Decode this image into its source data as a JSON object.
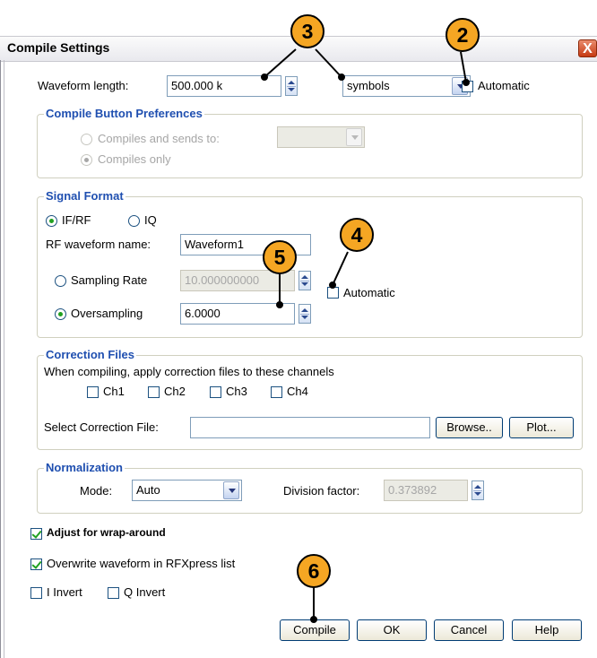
{
  "window": {
    "title": "Compile Settings",
    "close_glyph": "X"
  },
  "waveform": {
    "length_label": "Waveform length:",
    "length_value": "500.000 k",
    "unit_value": "symbols",
    "automatic_label": "Automatic",
    "automatic_checked": false
  },
  "compile_prefs": {
    "title": "Compile Button Preferences",
    "option_send_label": "Compiles and sends to:",
    "option_only_label": "Compiles only",
    "selected": "Compiles only"
  },
  "signal_format": {
    "title": "Signal Format",
    "ifrf_label": "IF/RF",
    "iq_label": "IQ",
    "selected": "IF/RF",
    "rf_name_label": "RF waveform name:",
    "rf_name_value": "Waveform1",
    "sampling_rate_label": "Sampling Rate",
    "sampling_rate_value": "10.000000000",
    "oversampling_label": "Oversampling",
    "oversampling_value": "6.0000",
    "automatic_label": "Automatic",
    "automatic_checked": false
  },
  "correction": {
    "title": "Correction Files",
    "description": "When compiling, apply correction files to these channels",
    "channels": [
      "Ch1",
      "Ch2",
      "Ch3",
      "Ch4"
    ],
    "select_label": "Select Correction File:",
    "file_value": "",
    "browse_label": "Browse..",
    "plot_label": "Plot..."
  },
  "normalization": {
    "title": "Normalization",
    "mode_label": "Mode:",
    "mode_value": "Auto",
    "division_label": "Division factor:",
    "division_value": "0.373892"
  },
  "options": {
    "wrap_label": "Adjust for wrap-around",
    "wrap_checked": true,
    "overwrite_label": "Overwrite waveform in RFXpress list",
    "overwrite_checked": true,
    "i_invert_label": "I Invert",
    "q_invert_label": "Q Invert"
  },
  "buttons": {
    "compile": "Compile",
    "ok": "OK",
    "cancel": "Cancel",
    "help": "Help"
  },
  "callouts": {
    "c2": "2",
    "c3": "3",
    "c4": "4",
    "c5": "5",
    "c6": "6"
  },
  "colors": {
    "callout": "#f5a623",
    "group_title": "#1f4fb0",
    "check": "#21a121"
  }
}
